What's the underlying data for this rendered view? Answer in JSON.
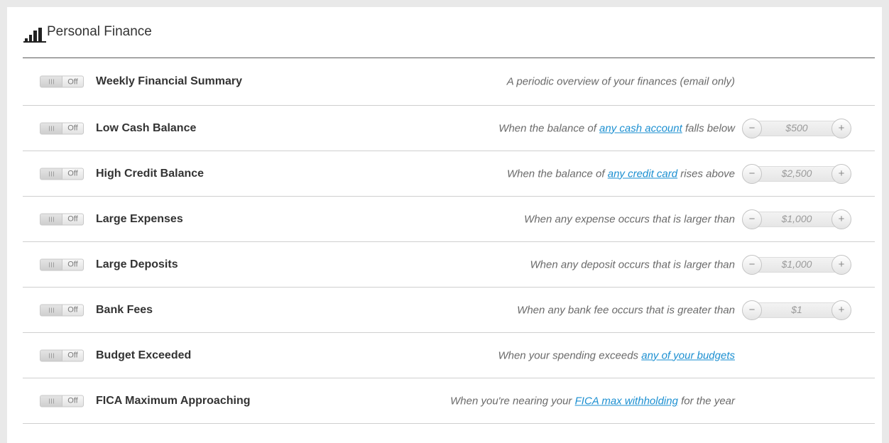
{
  "header": {
    "title": "Personal Finance",
    "icon": "bar-chart-icon"
  },
  "toggle_state": "Off",
  "alerts": [
    {
      "name": "Weekly Financial Summary",
      "desc": [
        {
          "t": "A periodic overview of your finances (email only)"
        }
      ]
    },
    {
      "name": "Low Cash Balance",
      "desc": [
        {
          "t": "When the balance of "
        },
        {
          "t": "any cash account",
          "link": true
        },
        {
          "t": " falls below"
        }
      ],
      "amount": "$500"
    },
    {
      "name": "High Credit Balance",
      "desc": [
        {
          "t": "When the balance of "
        },
        {
          "t": "any credit card",
          "link": true
        },
        {
          "t": " rises above"
        }
      ],
      "amount": "$2,500"
    },
    {
      "name": "Large Expenses",
      "desc": [
        {
          "t": "When any expense occurs that is larger than"
        }
      ],
      "amount": "$1,000"
    },
    {
      "name": "Large Deposits",
      "desc": [
        {
          "t": "When any deposit occurs that is larger than"
        }
      ],
      "amount": "$1,000"
    },
    {
      "name": "Bank Fees",
      "desc": [
        {
          "t": "When any bank fee occurs that is greater than"
        }
      ],
      "amount": "$1"
    },
    {
      "name": "Budget Exceeded",
      "desc": [
        {
          "t": "When your spending exceeds "
        },
        {
          "t": "any of your budgets",
          "link": true
        }
      ]
    },
    {
      "name": "FICA Maximum Approaching",
      "desc": [
        {
          "t": "When you're nearing your "
        },
        {
          "t": "FICA max withholding",
          "link": true
        },
        {
          "t": " for the year"
        }
      ]
    }
  ],
  "colors": {
    "link": "#1b8fd1",
    "text": "#333333",
    "muted": "#6a6a6a"
  }
}
